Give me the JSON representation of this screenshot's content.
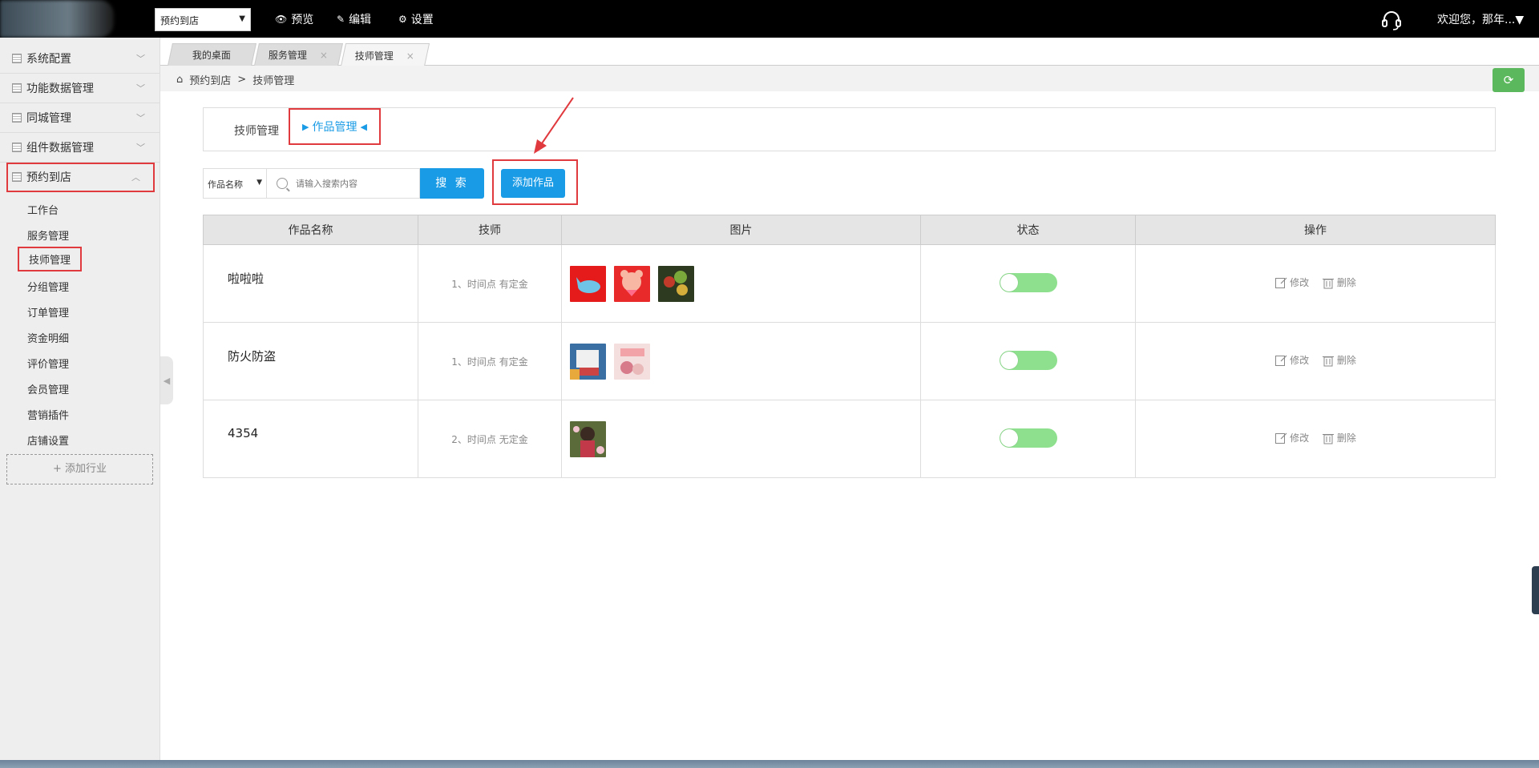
{
  "topbar": {
    "store_select": "预约到店",
    "links": [
      {
        "icon": "eye-icon",
        "label": "预览"
      },
      {
        "icon": "edit-icon",
        "label": "编辑"
      },
      {
        "icon": "gear-icon",
        "label": "设置"
      }
    ],
    "welcome": "欢迎您，那年...▼"
  },
  "sidebar": {
    "groups": [
      {
        "label": "系统配置"
      },
      {
        "label": "功能数据管理"
      },
      {
        "label": "同城管理"
      },
      {
        "label": "组件数据管理"
      },
      {
        "label": "预约到店"
      }
    ],
    "items": [
      {
        "label": "工作台"
      },
      {
        "label": "服务管理"
      },
      {
        "label": "技师管理"
      },
      {
        "label": "分组管理"
      },
      {
        "label": "订单管理"
      },
      {
        "label": "资金明细"
      },
      {
        "label": "评价管理"
      },
      {
        "label": "会员管理"
      },
      {
        "label": "营销插件"
      },
      {
        "label": "店铺设置"
      }
    ],
    "add_industry": "+ 添加行业"
  },
  "tabs": [
    {
      "label": "我的桌面"
    },
    {
      "label": "服务管理",
      "close": "×"
    },
    {
      "label": "技师管理",
      "close": "×"
    }
  ],
  "breadcrumb": {
    "home": "预约到店",
    "sep": ">",
    "current": "技师管理"
  },
  "subnav": {
    "first": "技师管理",
    "current": "作品管理"
  },
  "filter": {
    "select_value": "作品名称",
    "search_placeholder": "请输入搜索内容",
    "search_button": "搜 索",
    "add_button": "添加作品"
  },
  "table": {
    "headers": [
      "作品名称",
      "技师",
      "图片",
      "状态",
      "操作"
    ],
    "rows": [
      {
        "name": "啦啦啦",
        "tech": "1、时间点 有定金"
      },
      {
        "name": "防火防盗",
        "tech": "1、时间点 有定金"
      },
      {
        "name": "4354",
        "tech": "2、时间点 无定金"
      }
    ],
    "edit_label": "修改",
    "delete_label": "删除"
  },
  "colors": {
    "accent": "#1a9be6",
    "highlight": "#e0393e",
    "toggle_on": "#8ee08e",
    "refresh": "#5cb85c"
  }
}
